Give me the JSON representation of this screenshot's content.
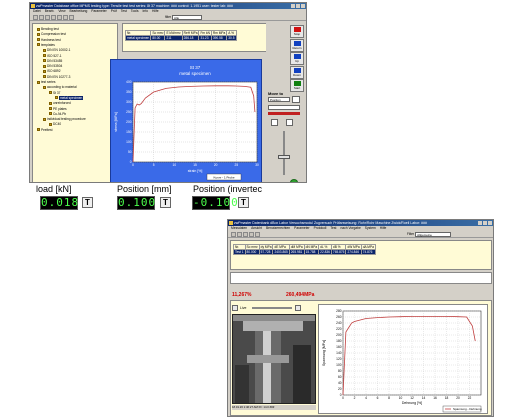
{
  "win1": {
    "title": "zwPmaster  Database office MPMS  testing type: Tensile test  test series: 8t 37  machine: ###  control: 1.1951  user: tester  lab: ###",
    "menu": [
      "Datei",
      "Bearb.",
      "View",
      "Bearbeitung",
      "Parameter",
      "Prüf",
      "Test",
      "Tools",
      "Info",
      "Hilfe"
    ],
    "filter_label": "filter",
    "filter_value": "Alle"
  },
  "tree": [
    {
      "label": "Bending test",
      "sel": false
    },
    {
      "label": "Compression test",
      "sel": false
    },
    {
      "label": "Hardness test",
      "sel": false
    },
    {
      "label": "templates",
      "sel": false
    },
    {
      "label": "DIN EN 10002-1",
      "sel": false
    },
    {
      "label": "ISO 527-1",
      "sel": false
    },
    {
      "label": "DIN 53455",
      "sel": false
    },
    {
      "label": "DIN 53504",
      "sel": false
    },
    {
      "label": "ISO 6892",
      "sel": false
    },
    {
      "label": "DIN EN 10277-3",
      "sel": false
    },
    {
      "label": "test series",
      "sel": false
    },
    {
      "label": "according to material",
      "sel": false
    },
    {
      "label": "St 37",
      "sel": false
    },
    {
      "label": "metal specimen",
      "sel": true
    },
    {
      "label": "unreinforced",
      "sel": false
    },
    {
      "label": "PE plates",
      "sel": false
    },
    {
      "label": "Cu-Ni-Pb",
      "sel": false
    },
    {
      "label": "individual testing procedure",
      "sel": false
    },
    {
      "label": "DC40",
      "sel": false
    },
    {
      "label": "Peeltest",
      "sel": false
    }
  ],
  "results_table": {
    "headers": [
      "Nr.",
      "So mm²",
      "E kN/mm²",
      "ReH MPa",
      "Fm kN",
      "Rm MPa",
      "A %"
    ],
    "rows": [
      [
        "metal specimen",
        "80.00",
        "211",
        "286.18",
        "31.23",
        "390.58",
        "30.5"
      ]
    ]
  },
  "chart1": {
    "title": "St 37",
    "subtitle": "metal specimen",
    "ylabel": "stress [MPa]",
    "xlabel": "strain [%]",
    "legend": "Kurve - 1 Probe"
  },
  "chart_data": [
    {
      "type": "line",
      "title": "St 37",
      "subtitle": "metal specimen",
      "xlabel": "strain [%]",
      "ylabel": "stress [MPa]",
      "xlim": [
        0,
        30
      ],
      "ylim": [
        0,
        400
      ],
      "xticks": [
        "0",
        "5",
        "10",
        "15",
        "20",
        "25",
        "30"
      ],
      "yticks": [
        "0",
        "50",
        "100",
        "150",
        "200",
        "250",
        "300",
        "350",
        "400"
      ],
      "series": [
        {
          "name": "Kurve - 1 Probe",
          "x": [
            0,
            0.5,
            1,
            1.5,
            2,
            3,
            5,
            8,
            11,
            14,
            17,
            20,
            23,
            25,
            27,
            28.5,
            29.2,
            29.5
          ],
          "y": [
            0,
            270,
            290,
            285,
            292,
            320,
            350,
            368,
            375,
            378,
            380,
            381,
            381,
            380,
            378,
            374,
            330,
            250
          ]
        }
      ],
      "grid": true
    },
    {
      "type": "line",
      "xlabel": "Dehnung [%]",
      "ylabel": "Spannung [MPa]",
      "xlim": [
        0,
        24
      ],
      "ylim": [
        0,
        280
      ],
      "xticks": [
        "0",
        "2",
        "4",
        "6",
        "8",
        "10",
        "12",
        "14",
        "16",
        "18",
        "20",
        "22"
      ],
      "yticks": [
        "0",
        "20",
        "40",
        "60",
        "80",
        "100",
        "120",
        "140",
        "160",
        "180",
        "200",
        "220",
        "240",
        "260",
        "280"
      ],
      "series": [
        {
          "name": "Spannung - Dehnung",
          "x": [
            0,
            0.5,
            1,
            1.5,
            2,
            3,
            4,
            6,
            8,
            10,
            12,
            14,
            16,
            18,
            20,
            21.5,
            22.5,
            23
          ],
          "y": [
            0,
            210,
            225,
            240,
            245,
            250,
            255,
            258,
            260,
            261,
            262,
            262,
            262,
            262,
            261,
            260,
            230,
            180
          ]
        }
      ],
      "grid": true
    }
  ],
  "side_buttons": [
    {
      "label": "Stop",
      "icon": "stop-icon",
      "color": "#d01010"
    },
    {
      "label": "Return",
      "icon": "return-icon",
      "color": "#1040c0"
    },
    {
      "label": "Up",
      "icon": "up-arrow-icon",
      "color": "#1040c0"
    },
    {
      "label": "Down",
      "icon": "down-arrow-icon",
      "color": "#1040c0"
    },
    {
      "label": "Start",
      "icon": "start-icon",
      "color": "#108010"
    }
  ],
  "move_to": {
    "label": "Move to",
    "select": "Position"
  },
  "channels": [
    {
      "label": "load [kN]",
      "value": "0.018",
      "t": "T"
    },
    {
      "label": "Position [mm]",
      "value": "0.100",
      "t": "T"
    },
    {
      "label": "Position (invertec",
      "value": "-0.100",
      "t": "T"
    }
  ],
  "win2": {
    "title": "zwPmaster  Datenbank dBox Labor  Versuchsmodul Zugversuch  Prüfanweisung: Rohr/Rohr  Maschine Zwick/Roell  Labor: ###",
    "menu": [
      "Messdaten",
      "Ansicht",
      "Benutzerrechten",
      "Parameter",
      "Protokoll",
      "Test",
      "nach Vorgabe",
      "System",
      "Hilfe"
    ],
    "filter_label": "Filter",
    "filter_value": "Allgemeine"
  },
  "results_table2": {
    "headers": [
      "Nr.",
      "So mm²",
      "dy MPa",
      "dE MPa",
      "dM MPa",
      "dN MPa",
      "dL %",
      "dB %",
      "dW MPa",
      "dA MPa"
    ],
    "rows": [
      [
        "Test 1",
        "80.000",
        "57.728",
        "2403.865",
        "265.981",
        "15.788",
        "22.836",
        "765.875",
        "274.846",
        "74.876"
      ]
    ]
  },
  "readouts": {
    "strain": "11,267%",
    "stress": "260,494MPa"
  },
  "video": {
    "label": "Live",
    "status": "18.01.26 1:46:27 AM  Pc: 14.0  ###"
  },
  "legend2": "Spannung - Dehnung",
  "colors": {
    "accent": "#0a246a",
    "chart_bg": "#3a6ae8",
    "lcd_text": "#4cff4c",
    "curve": "#c04040",
    "readout": "#d00000"
  }
}
